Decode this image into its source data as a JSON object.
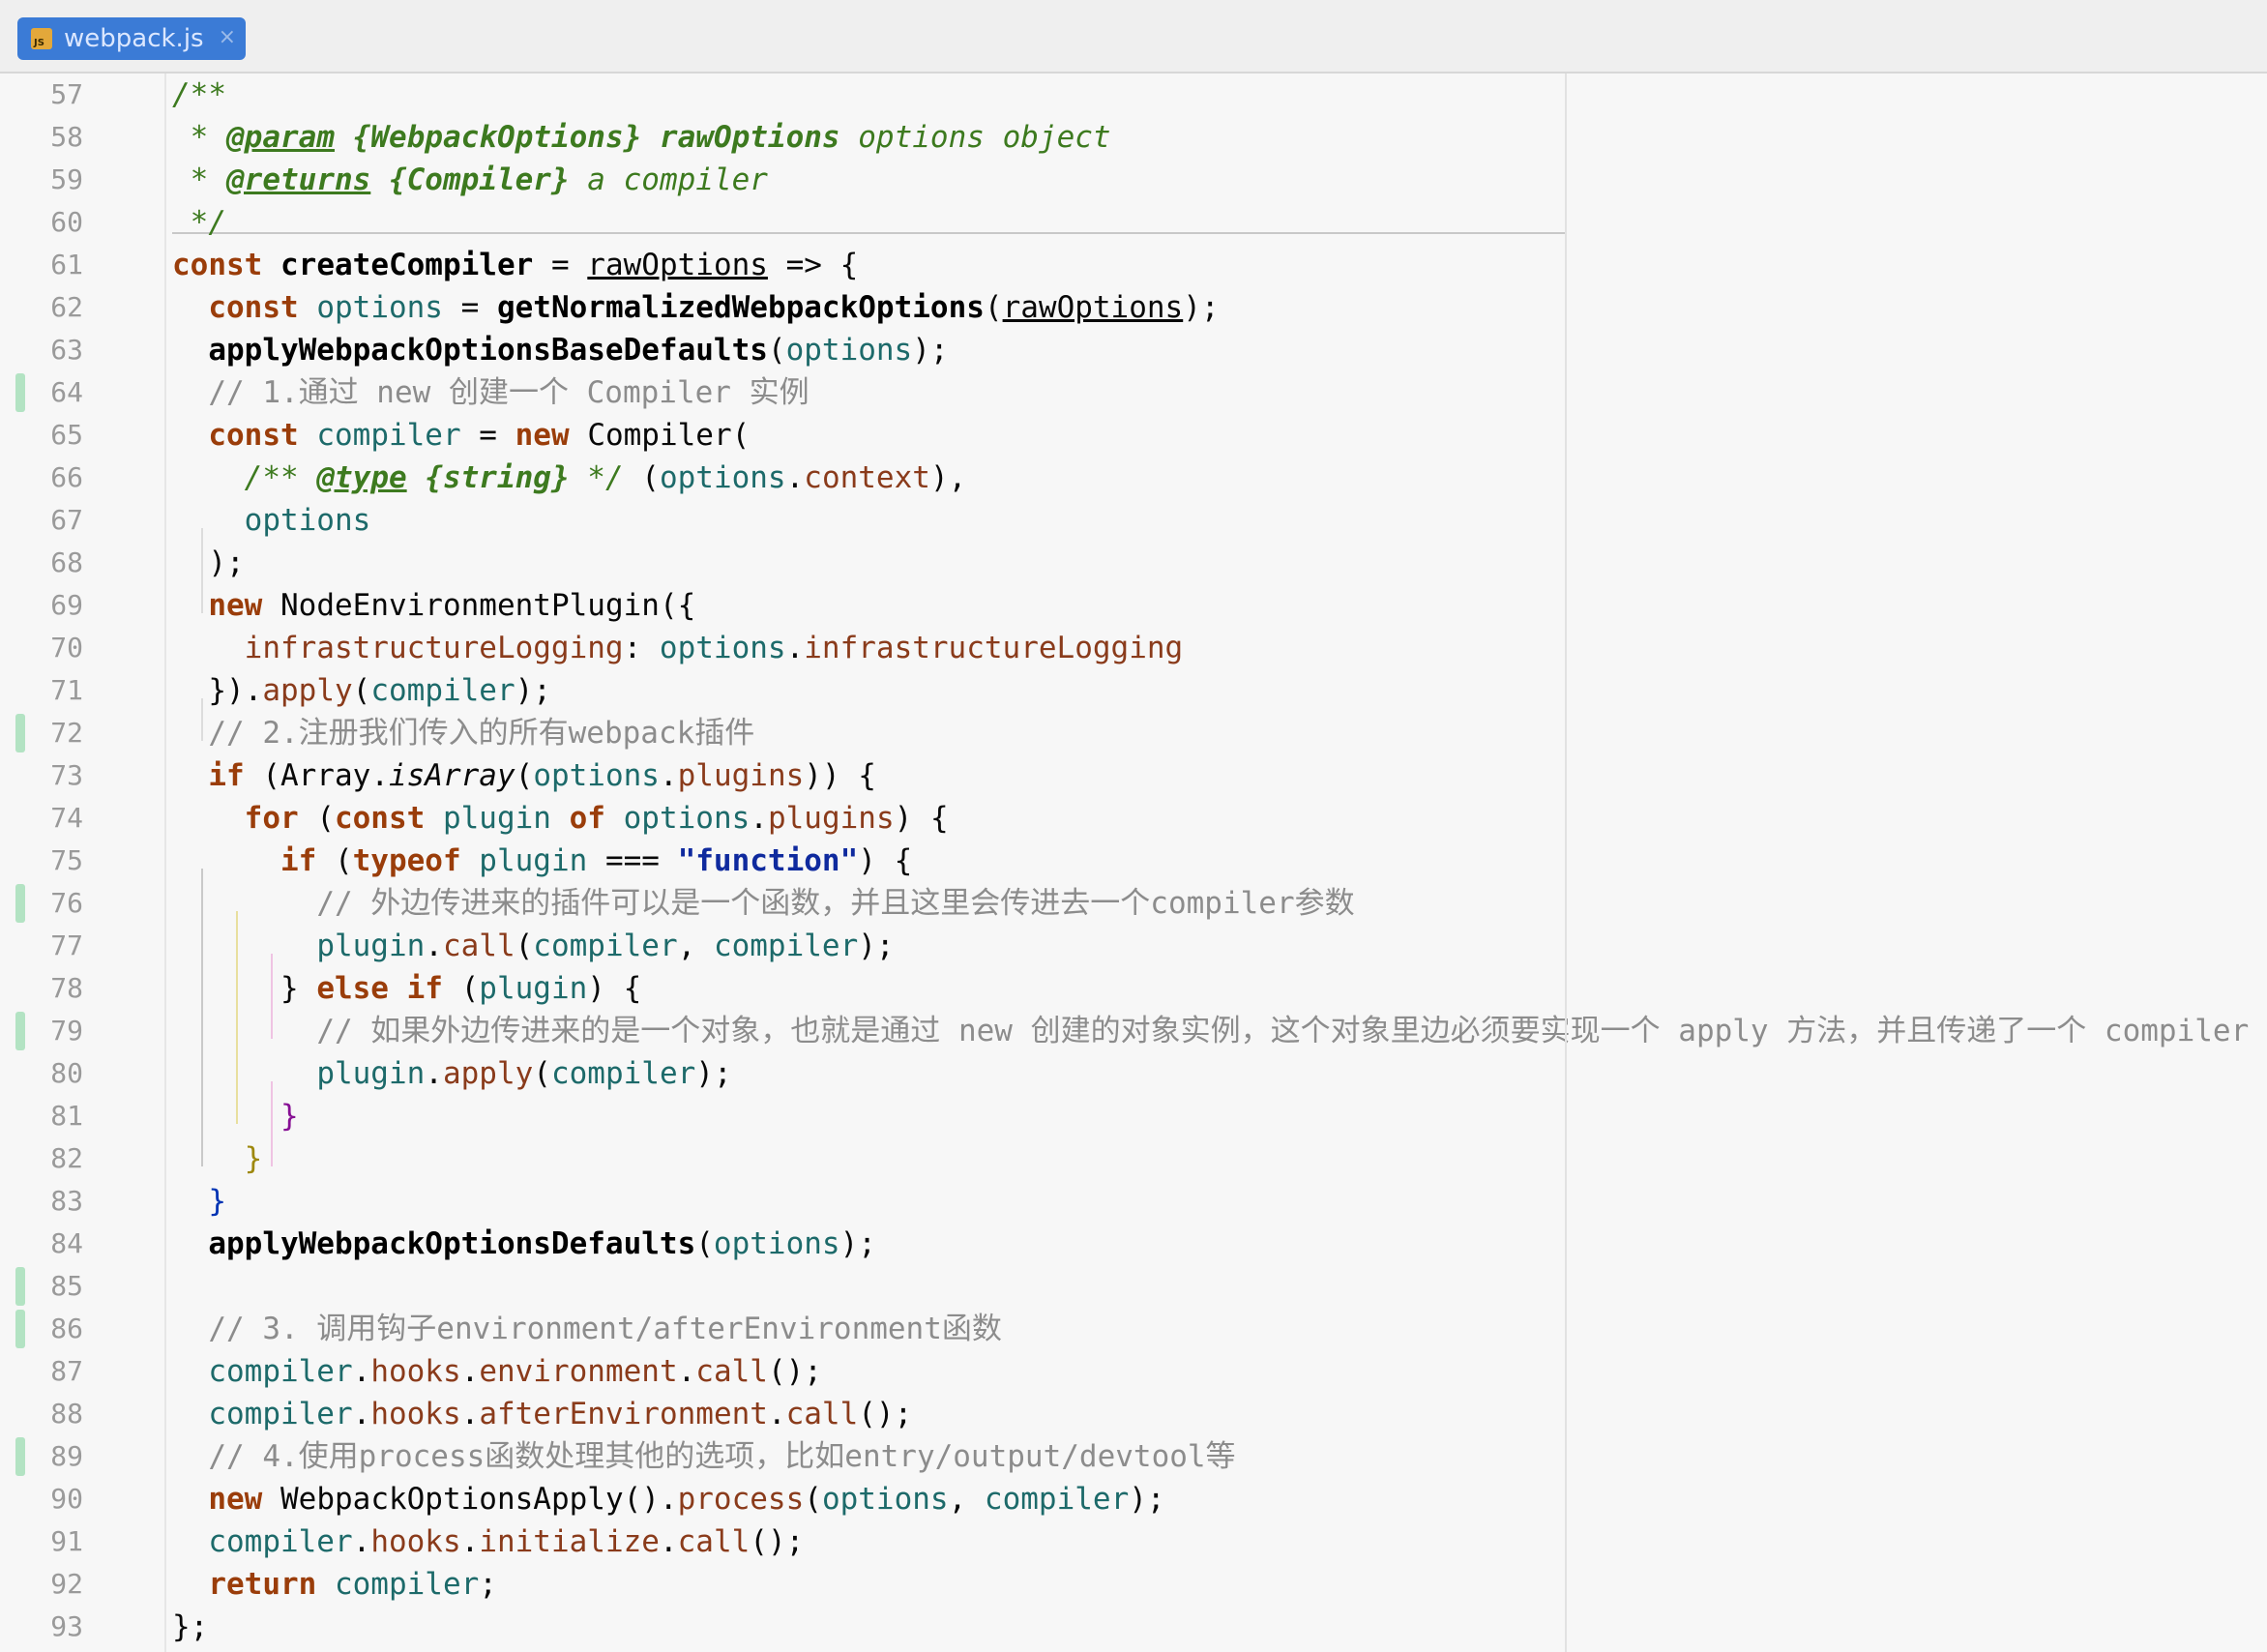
{
  "tab": {
    "file_type_label": "JS",
    "filename": "webpack.js",
    "close_glyph": "×"
  },
  "gutter": {
    "line_numbers": [
      "57",
      "58",
      "59",
      "60",
      "61",
      "62",
      "63",
      "64",
      "65",
      "66",
      "67",
      "68",
      "69",
      "70",
      "71",
      "72",
      "73",
      "74",
      "75",
      "76",
      "77",
      "78",
      "79",
      "80",
      "81",
      "82",
      "83",
      "84",
      "85",
      "86",
      "87",
      "88",
      "89",
      "90",
      "91",
      "92",
      "93"
    ],
    "changed_lines": [
      "64",
      "72",
      "76",
      "79",
      "85",
      "86",
      "89"
    ]
  },
  "code": {
    "l57": "/**",
    "l58": {
      "star": " * ",
      "tag": "@param",
      "type": "{WebpackOptions}",
      "name": "rawOptions",
      "desc": "options object"
    },
    "l59": {
      "star": " * ",
      "tag": "@returns",
      "type": "{Compiler}",
      "desc": "a compiler"
    },
    "l60": " */",
    "l61": {
      "kw": "const",
      "name": "createCompiler",
      "eq": " = ",
      "param": "rawOptions",
      "arrow": " => {"
    },
    "l62": {
      "kw": "const",
      "var": "options",
      "eq": " = ",
      "fn": "getNormalizedWebpackOptions",
      "arg": "rawOptions",
      "end": ");"
    },
    "l63": {
      "fn": "applyWebpackOptionsBaseDefaults",
      "arg": "options",
      "end": ");"
    },
    "l64": "// 1.通过 new 创建一个 Compiler 实例",
    "l65": {
      "kw": "const",
      "var": "compiler",
      "eq": " = ",
      "new": "new",
      "cls": "Compiler",
      "end": "("
    },
    "l66": {
      "open": "/** ",
      "tag": "@type",
      "type": "{string}",
      "close": " */",
      "expr_open": " (",
      "obj": "options",
      "prop": "context",
      "expr_close": "),"
    },
    "l67": "options",
    "l68": ");",
    "l69": {
      "new": "new",
      "cls": "NodeEnvironmentPlugin",
      "end": "({"
    },
    "l70": {
      "key": "infrastructureLogging",
      "colon": ": ",
      "obj": "options",
      "prop": "infrastructureLogging"
    },
    "l71": {
      "start": "}).",
      "fn": "apply",
      "arg": "compiler",
      "end": ");"
    },
    "l72": "// 2.注册我们传入的所有webpack插件",
    "l73": {
      "kw": "if",
      "open": " (",
      "cls": "Array",
      "fn": "isArray",
      "obj": "options",
      "prop": "plugins",
      "end": ")) {"
    },
    "l74": {
      "kw": "for",
      "open": " (",
      "kw2": "const",
      "var": "plugin",
      "of": "of",
      "obj": "options",
      "prop": "plugins",
      "end": ") {"
    },
    "l75": {
      "kw": "if",
      "open": " (",
      "typeof": "typeof",
      "var": "plugin",
      "op": " === ",
      "str": "\"function\"",
      "end": ") {"
    },
    "l76": "// 外边传进来的插件可以是一个函数，并且这里会传进去一个compiler参数",
    "l77": {
      "obj": "plugin",
      "fn": "call",
      "arg1": "compiler",
      "arg2": "compiler",
      "end": ");"
    },
    "l78": {
      "close": "} ",
      "kw": "else",
      "kw2": "if",
      "open": " (",
      "var": "plugin",
      "end": ") {"
    },
    "l79": "// 如果外边传进来的是一个对象，也就是通过 new 创建的对象实例，这个对象里边必须要实现一个 apply 方法，并且传递了一个 compiler 参数",
    "l80": {
      "obj": "plugin",
      "fn": "apply",
      "arg": "compiler",
      "end": ");"
    },
    "l81": "}",
    "l82": "}",
    "l83": "}",
    "l84": {
      "fn": "applyWebpackOptionsDefaults",
      "arg": "options",
      "end": ");"
    },
    "l85": "",
    "l86": "// 3. 调用钩子environment/afterEnvironment函数",
    "l87": {
      "obj": "compiler",
      "p1": "hooks",
      "p2": "environment",
      "fn": "call",
      "end": "();"
    },
    "l88": {
      "obj": "compiler",
      "p1": "hooks",
      "p2": "afterEnvironment",
      "fn": "call",
      "end": "();"
    },
    "l89": "// 4.使用process函数处理其他的选项，比如entry/output/devtool等",
    "l90": {
      "new": "new",
      "cls": "WebpackOptionsApply",
      "mid": "().",
      "fn": "process",
      "arg1": "options",
      "arg2": "compiler",
      "end": ");"
    },
    "l91": {
      "obj": "compiler",
      "p1": "hooks",
      "p2": "initialize",
      "fn": "call",
      "end": "();"
    },
    "l92": {
      "kw": "return",
      "var": "compiler",
      "end": ";"
    },
    "l93": "};"
  },
  "colors": {
    "tab_active": "#3b7bd6",
    "change_marker": "#b3e3c3",
    "comment": "#8c8c8c",
    "doc_comment": "#3d7a1f",
    "keyword": "#9a3d0a"
  }
}
